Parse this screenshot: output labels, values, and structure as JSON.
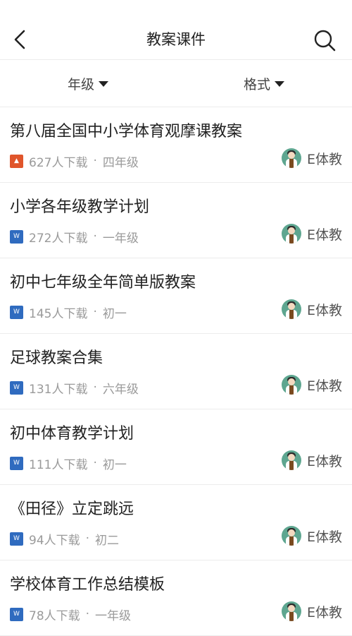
{
  "header": {
    "title": "教案课件"
  },
  "filters": {
    "grade": "年级",
    "format": "格式"
  },
  "items": [
    {
      "title": "第八届全国中小学体育观摩课教案",
      "downloads": "627人下载",
      "level": "四年级",
      "file_type": "pdf",
      "author": "E体教"
    },
    {
      "title": "小学各年级教学计划",
      "downloads": "272人下载",
      "level": "一年级",
      "file_type": "word",
      "author": "E体教"
    },
    {
      "title": "初中七年级全年简单版教案",
      "downloads": "145人下载",
      "level": "初一",
      "file_type": "word",
      "author": "E体教"
    },
    {
      "title": "足球教案合集",
      "downloads": "131人下载",
      "level": "六年级",
      "file_type": "word",
      "author": "E体教"
    },
    {
      "title": "初中体育教学计划",
      "downloads": "111人下载",
      "level": "初一",
      "file_type": "word",
      "author": "E体教"
    },
    {
      "title": "《田径》立定跳远",
      "downloads": "94人下载",
      "level": "初二",
      "file_type": "word",
      "author": "E体教"
    },
    {
      "title": "学校体育工作总结模板",
      "downloads": "78人下载",
      "level": "一年级",
      "file_type": "word",
      "author": "E体教"
    }
  ],
  "meta_separator": " · ",
  "icons": {
    "pdf": "pdf-file-icon",
    "word": "word-file-icon",
    "back": "back-arrow-icon",
    "search": "search-icon"
  },
  "colors": {
    "pdf": "#e0552b",
    "word": "#2f6bbf",
    "avatar_bg": "#5ea690"
  }
}
